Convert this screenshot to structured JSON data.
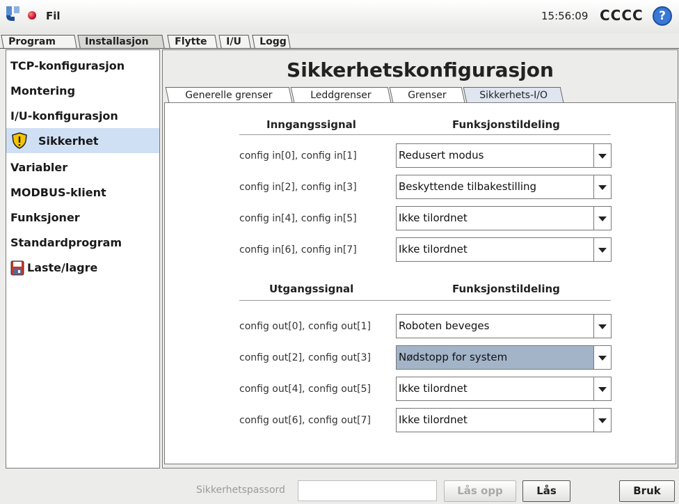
{
  "header": {
    "file_label": "Fil",
    "time": "15:56:09",
    "robot_name": "CCCC",
    "help_symbol": "?"
  },
  "main_tabs": [
    {
      "label": "Program",
      "active": false
    },
    {
      "label": "Installasjon",
      "active": true
    },
    {
      "label": "Flytte",
      "active": false
    },
    {
      "label": "I/U",
      "active": false
    },
    {
      "label": "Logg",
      "active": false
    }
  ],
  "sidebar": {
    "items": [
      {
        "label": "TCP-konfigurasjon"
      },
      {
        "label": "Montering"
      },
      {
        "label": "I/U-konfigurasjon"
      },
      {
        "label": "Sikkerhet",
        "icon": "warning-shield-icon",
        "active": true
      },
      {
        "label": "Variabler"
      },
      {
        "label": "MODBUS-klient"
      },
      {
        "label": "Funksjoner"
      },
      {
        "label": "Standardprogram"
      },
      {
        "label": "Laste/lagre",
        "icon": "save-disk-icon"
      }
    ]
  },
  "content": {
    "title": "Sikkerhetskonfigurasjon",
    "sub_tabs": [
      {
        "label": "Generelle grenser"
      },
      {
        "label": "Leddgrenser"
      },
      {
        "label": "Grenser"
      },
      {
        "label": "Sikkerhets-I/O",
        "active": true
      }
    ],
    "inputs": {
      "header_signal": "Inngangssignal",
      "header_function": "Funksjonstildeling",
      "rows": [
        {
          "signal": "config in[0], config in[1]",
          "value": "Redusert modus"
        },
        {
          "signal": "config in[2], config in[3]",
          "value": "Beskyttende tilbakestilling"
        },
        {
          "signal": "config in[4], config in[5]",
          "value": "Ikke tilordnet"
        },
        {
          "signal": "config in[6], config in[7]",
          "value": "Ikke tilordnet"
        }
      ]
    },
    "outputs": {
      "header_signal": "Utgangssignal",
      "header_function": "Funksjonstildeling",
      "rows": [
        {
          "signal": "config out[0], config out[1]",
          "value": "Roboten beveges"
        },
        {
          "signal": "config out[2], config out[3]",
          "value": "Nødstopp for system",
          "highlighted": true
        },
        {
          "signal": "config out[4], config out[5]",
          "value": "Ikke tilordnet"
        },
        {
          "signal": "config out[6], config out[7]",
          "value": "Ikke tilordnet"
        }
      ]
    }
  },
  "footer": {
    "password_label": "Sikkerhetspassord",
    "password_value": "",
    "unlock_label": "Lås opp",
    "lock_label": "Lås",
    "apply_label": "Bruk"
  },
  "colors": {
    "selected_sidebar": "#cfe0f5",
    "highlighted_dropdown": "#a3b4c9",
    "warning_icon": "#f5c400",
    "help_icon": "#3a78d6",
    "power_led": "#c8102e"
  }
}
